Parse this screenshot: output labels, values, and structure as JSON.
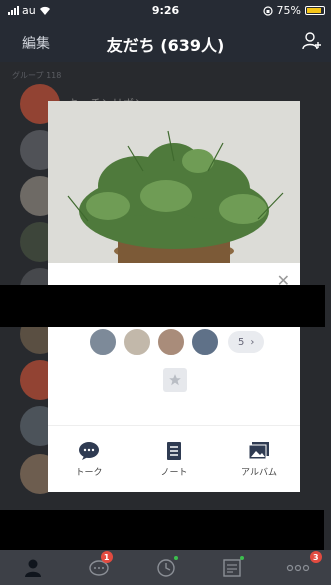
{
  "status_bar": {
    "carrier": "au",
    "time": "9:26",
    "battery_text": "75%",
    "battery_level": 0.75
  },
  "header": {
    "edit_label": "編集",
    "title": "友だち (639人)",
    "add_friend_icon": "add-user-icon"
  },
  "list": {
    "group_label": "グループ 118",
    "first_row_name": "キッチンリボン…"
  },
  "profile_card": {
    "close_icon": "close-icon",
    "more_count": "5",
    "favorite_icon": "star-icon",
    "actions": [
      {
        "label": "トーク",
        "icon": "chat-bubble-icon"
      },
      {
        "label": "ノート",
        "icon": "note-icon"
      },
      {
        "label": "アルバム",
        "icon": "album-icon"
      }
    ]
  },
  "tab_bar": {
    "tabs": [
      {
        "name": "friends",
        "icon": "person-icon"
      },
      {
        "name": "chats",
        "icon": "chat-icon",
        "badge": "1"
      },
      {
        "name": "timeline",
        "icon": "clock-icon",
        "dot": true
      },
      {
        "name": "news",
        "icon": "news-icon",
        "dot": true
      },
      {
        "name": "more",
        "icon": "more-icon",
        "badge": "3"
      }
    ]
  },
  "colors": {
    "header_bg": "#262b34",
    "badge_red": "#e24b40",
    "dot_green": "#3cbf4e",
    "battery_yellow": "#f5c518"
  }
}
